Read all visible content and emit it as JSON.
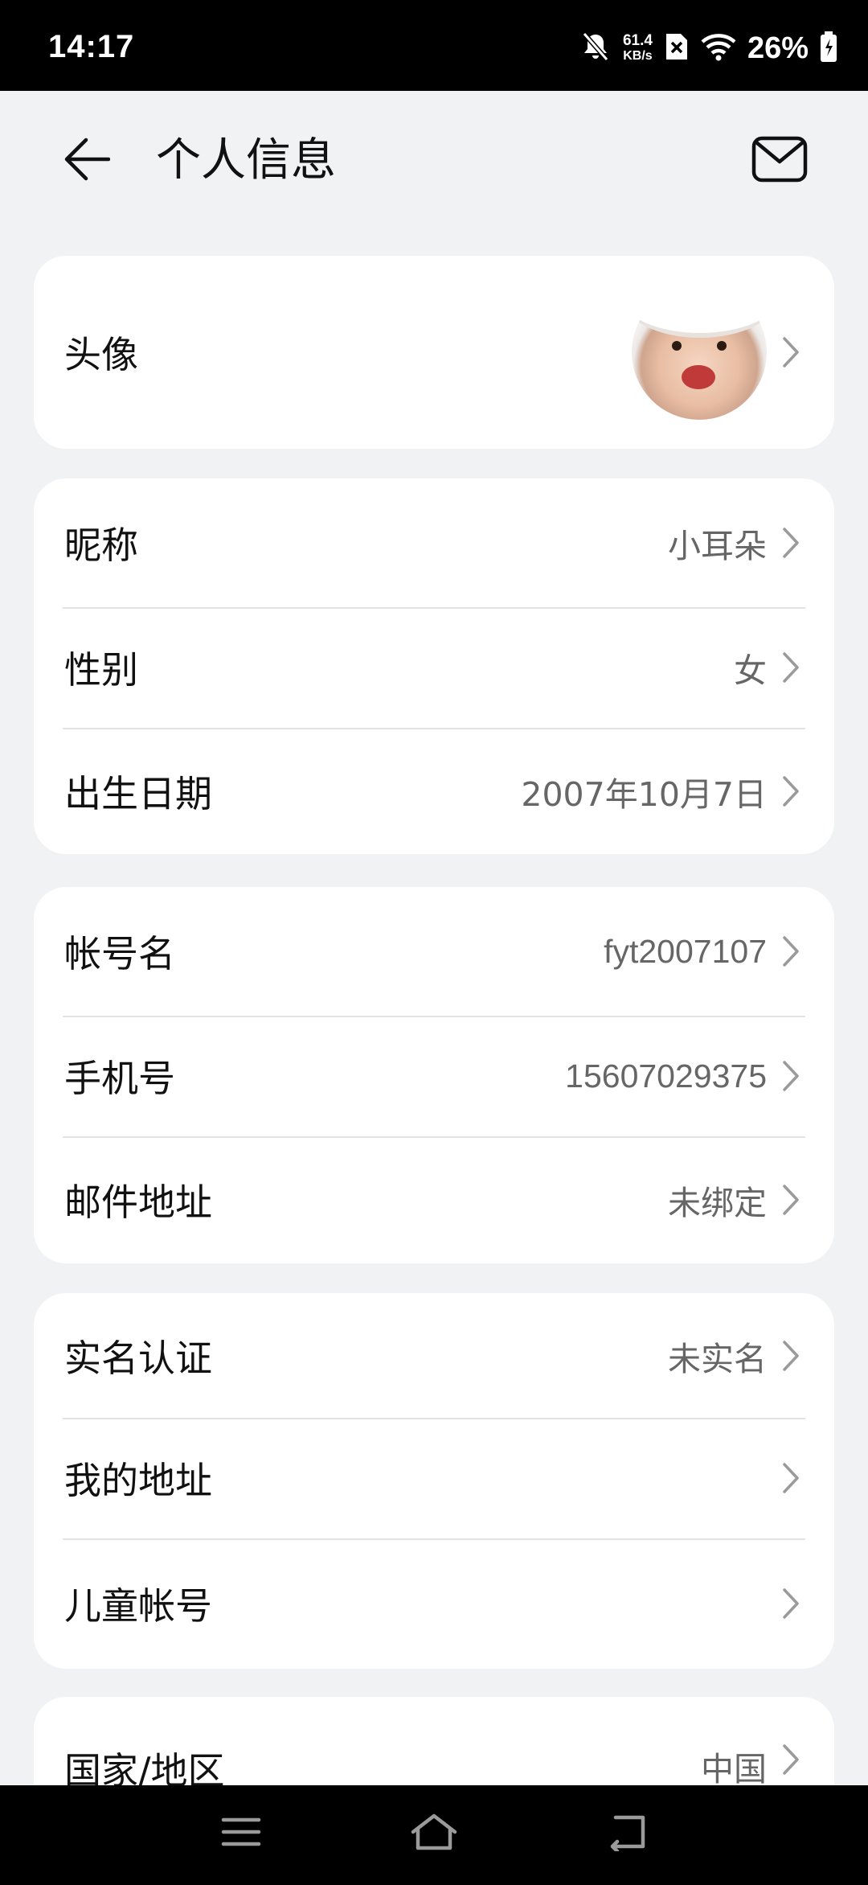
{
  "status_bar": {
    "time": "14:17",
    "net_speed_value": "61.4",
    "net_speed_unit": "KB/s",
    "battery": "26%"
  },
  "header": {
    "title": "个人信息"
  },
  "groups": [
    {
      "rows": [
        {
          "label": "头像",
          "value": ""
        }
      ]
    },
    {
      "rows": [
        {
          "label": "昵称",
          "value": "小耳朵"
        },
        {
          "label": "性别",
          "value": "女"
        },
        {
          "label": "出生日期",
          "value": "2007年10月7日"
        }
      ]
    },
    {
      "rows": [
        {
          "label": "帐号名",
          "value": "fyt2007107"
        },
        {
          "label": "手机号",
          "value": "15607029375"
        },
        {
          "label": "邮件地址",
          "value": "未绑定"
        }
      ]
    },
    {
      "rows": [
        {
          "label": "实名认证",
          "value": "未实名"
        },
        {
          "label": "我的地址",
          "value": ""
        },
        {
          "label": "儿童帐号",
          "value": ""
        }
      ]
    },
    {
      "rows": [
        {
          "label": "国家/地区",
          "value": "中国"
        }
      ]
    }
  ],
  "icons": {
    "back": "arrow-left-icon",
    "mail": "mail-icon",
    "chevron": "chevron-right-icon",
    "nav_menu": "menu-icon",
    "nav_home": "home-icon",
    "nav_back": "back-icon"
  },
  "colors": {
    "background": "#f1f2f4",
    "card": "#ffffff",
    "value_text": "#666666",
    "bars": "#000000"
  }
}
